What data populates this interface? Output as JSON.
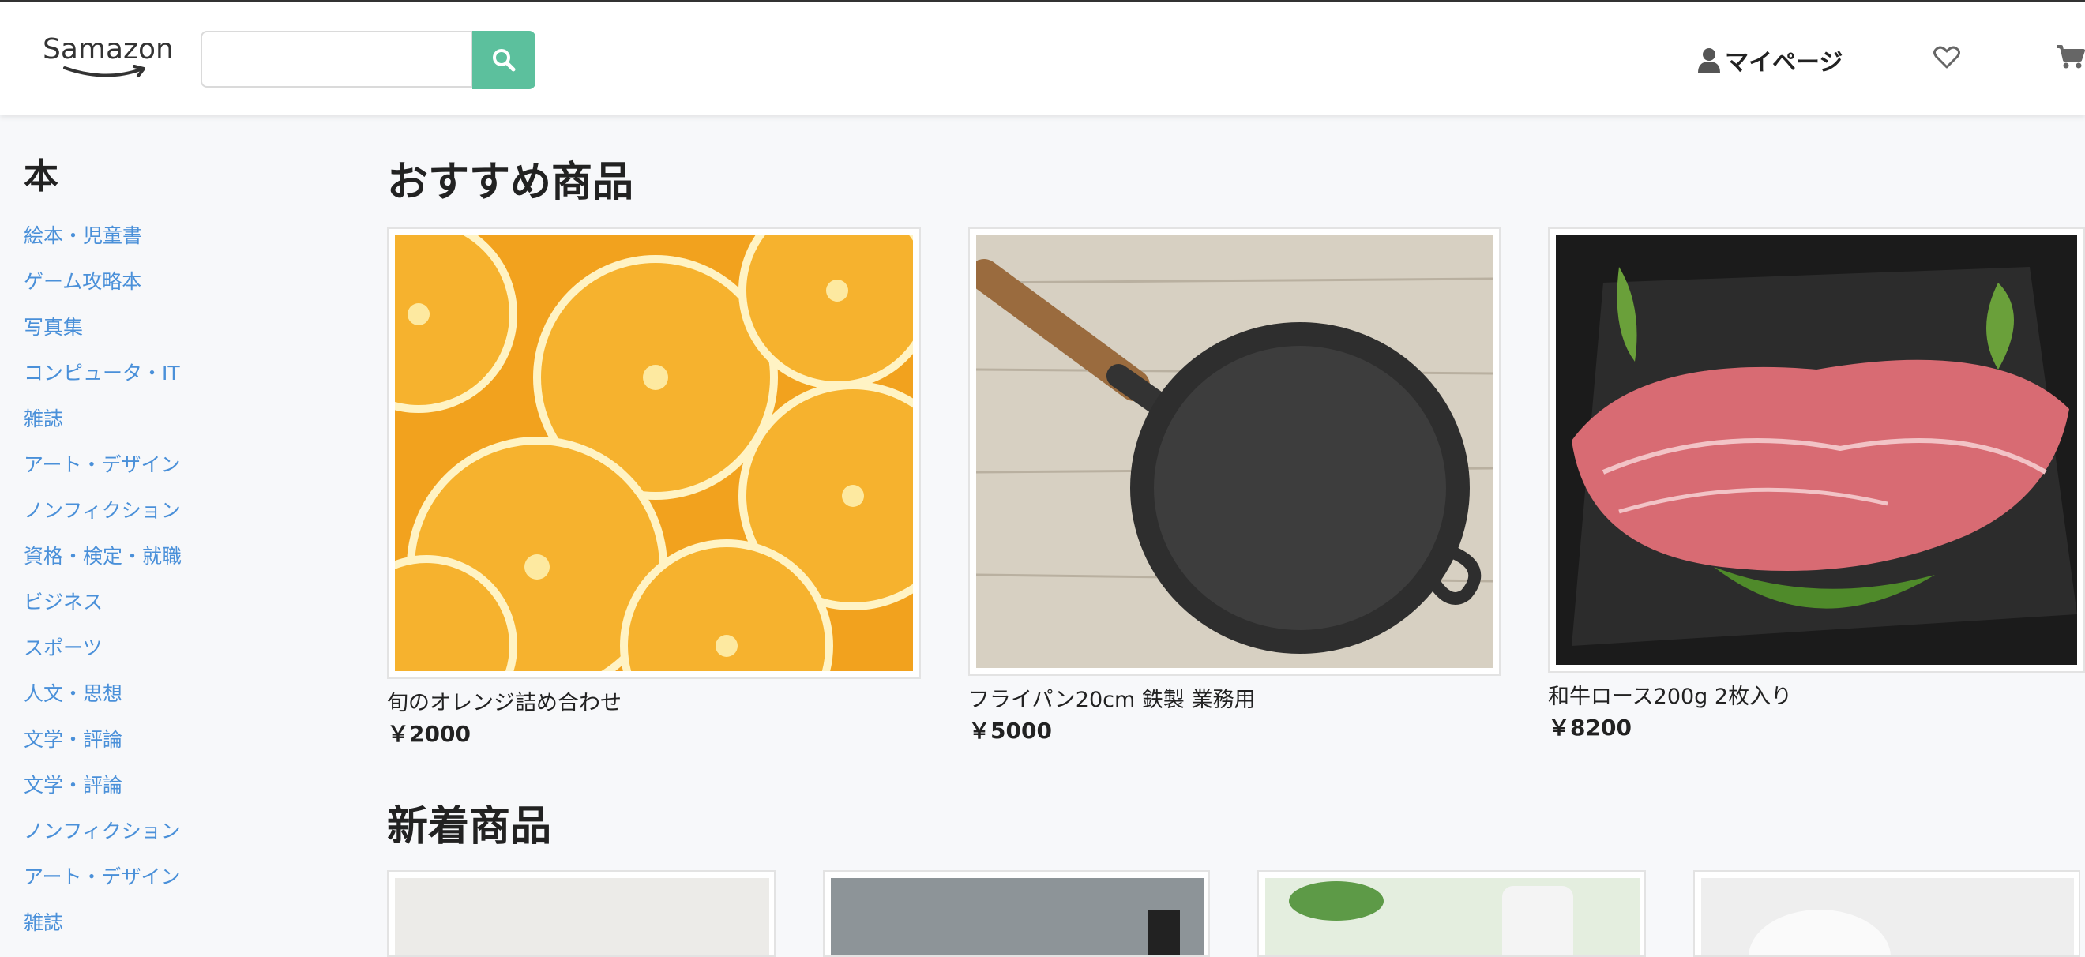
{
  "header": {
    "logo_text": "Samazon",
    "search_placeholder": "",
    "mypage_label": "マイページ"
  },
  "sidebar": {
    "title": "本",
    "items": [
      "絵本・児童書",
      "ゲーム攻略本",
      "写真集",
      "コンピュータ・IT",
      "雑誌",
      "アート・デザイン",
      "ノンフィクション",
      "資格・検定・就職",
      "ビジネス",
      "スポーツ",
      "人文・思想",
      "文学・評論",
      "文学・評論",
      "ノンフィクション",
      "アート・デザイン",
      "雑誌"
    ]
  },
  "main": {
    "recommended_title": "おすすめ商品",
    "recommended": [
      {
        "name": "旬のオレンジ詰め合わせ",
        "price": "￥2000",
        "image": "orange-slices"
      },
      {
        "name": "フライパン20cm 鉄製 業務用",
        "price": "￥5000",
        "image": "cast-iron-pan"
      },
      {
        "name": "和牛ロース200g 2枚入り",
        "price": "￥8200",
        "image": "wagyu-beef"
      }
    ],
    "new_title": "新着商品",
    "new_items": [
      {
        "image": "white-item"
      },
      {
        "image": "gray-item"
      },
      {
        "image": "plant-bottle"
      },
      {
        "image": "white-bowls"
      }
    ]
  },
  "colors": {
    "accent": "#5cc09d",
    "link": "#4a90d9",
    "background": "#f7f8fa"
  }
}
